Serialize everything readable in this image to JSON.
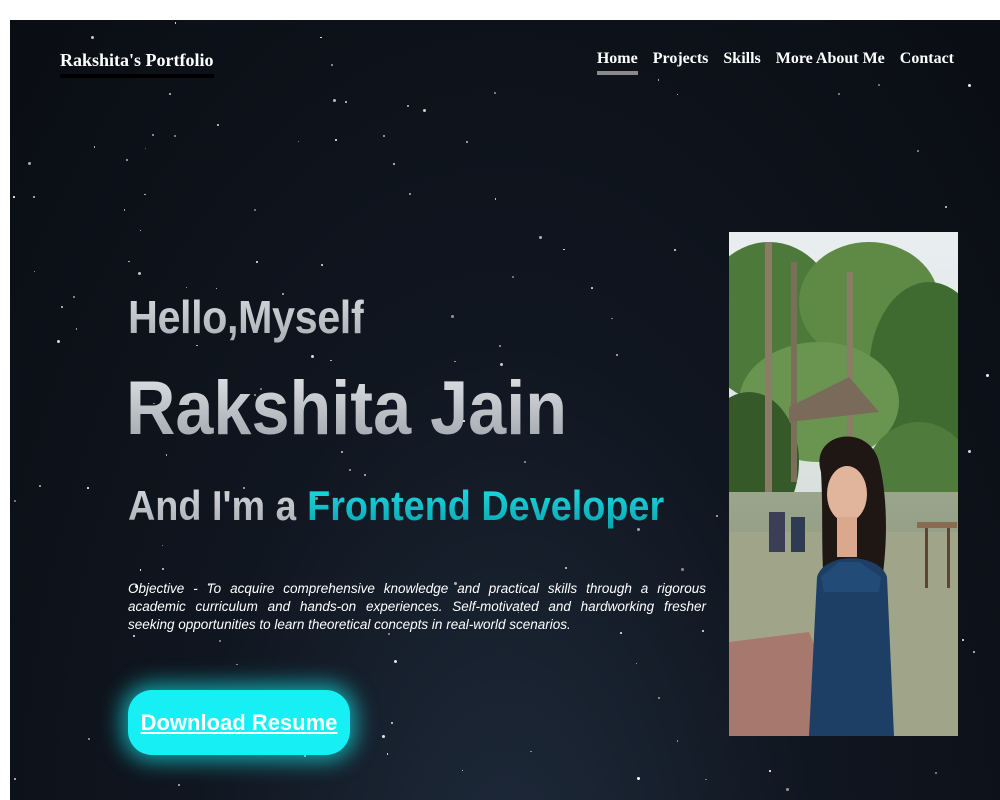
{
  "header": {
    "brand": "Rakshita's Portfolio",
    "nav": [
      {
        "label": "Home",
        "active": true
      },
      {
        "label": "Projects",
        "active": false
      },
      {
        "label": "Skills",
        "active": false
      },
      {
        "label": "More About Me",
        "active": false
      },
      {
        "label": "Contact",
        "active": false
      }
    ]
  },
  "hero": {
    "greeting": "Hello,Myself",
    "name": "Rakshita Jain",
    "role_prefix": "And I'm a",
    "role_highlight": "Frontend Developer",
    "objective": "Objective - To acquire comprehensive knowledge and practical skills through a rigorous academic curriculum and hands-on experiences. Self-motivated and hardworking fresher seeking opportunities to learn theoretical concepts in real-world scenarios.",
    "cta_label": "Download Resume"
  },
  "colors": {
    "accent": "#16f0f4",
    "highlight": "#1fcfd6",
    "background": "#0e131b"
  }
}
